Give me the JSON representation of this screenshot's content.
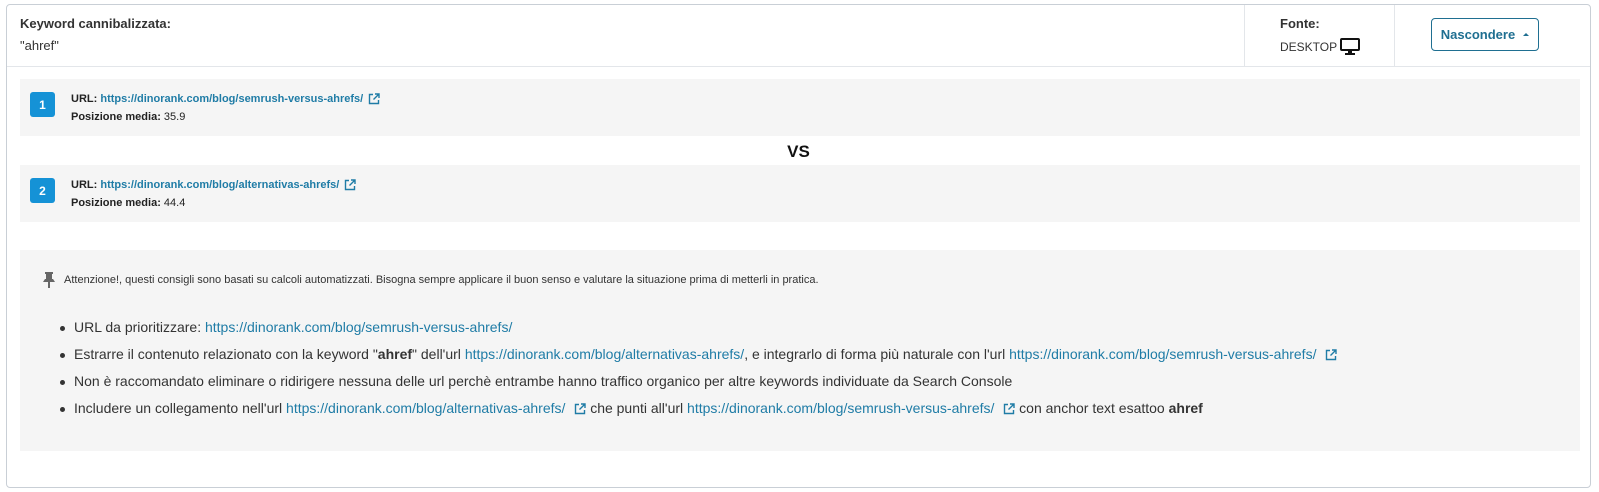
{
  "header": {
    "keyword_label": "Keyword cannibalizzata:",
    "keyword_value": "\"ahref\"",
    "source_label": "Fonte:",
    "source_value": "DESKTOP",
    "hide_button": "Nascondere"
  },
  "urls": [
    {
      "num": "1",
      "url_label": "URL:",
      "url": "https://dinorank.com/blog/semrush-versus-ahrefs/",
      "pos_label": "Posizione media:",
      "pos_value": "35.9"
    },
    {
      "num": "2",
      "url_label": "URL:",
      "url": "https://dinorank.com/blog/alternativas-ahrefs/",
      "pos_label": "Posizione media:",
      "pos_value": "44.4"
    }
  ],
  "vs": "VS",
  "advice": {
    "warning": "Attenzione!, questi consigli sono basati su calcoli automatizzati. Bisogna sempre applicare il buon senso e valutare la situazione prima di metterli in pratica.",
    "tip1": {
      "text": "URL da prioritizzare:",
      "url": "https://dinorank.com/blog/semrush-versus-ahrefs/"
    },
    "tip2": {
      "part1": "Estrarre il contenuto relazionato con la keyword \"",
      "keyword": "ahref",
      "part2": "\" dell'url",
      "url1": "https://dinorank.com/blog/alternativas-ahrefs/",
      "part3": ", e integrarlo di forma più naturale con l'url",
      "url2": "https://dinorank.com/blog/semrush-versus-ahrefs/"
    },
    "tip3": "Non è raccomandato eliminare o ridirigere nessuna delle url perchè entrambe hanno traffico organico per altre keywords individuate da Search Console",
    "tip4": {
      "part1": "Includere un collegamento nell'url",
      "url1": "https://dinorank.com/blog/alternativas-ahrefs/",
      "part2": "che punti all'url",
      "url2": "https://dinorank.com/blog/semrush-versus-ahrefs/",
      "part3": "con anchor text esattoo",
      "keyword": "ahref"
    }
  },
  "colors": {
    "accent": "#1592d6",
    "link": "#1f7ca6",
    "button": "#1f6f91"
  },
  "icons": [
    "desktop-icon",
    "external-link-icon",
    "pin-icon",
    "caret-up-icon"
  ]
}
